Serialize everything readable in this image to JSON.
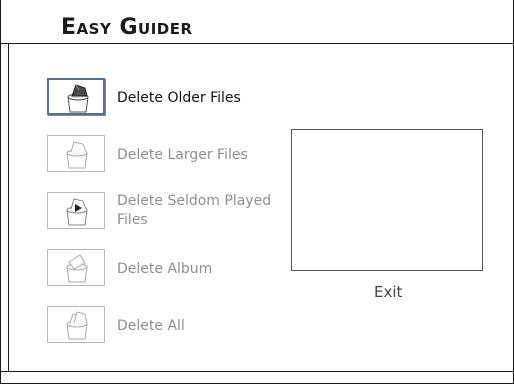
{
  "app": {
    "title": "Easy Guider"
  },
  "menu": {
    "items": [
      {
        "id": "older",
        "label": "Delete Older Files",
        "selected": true,
        "icon": "trash-bin-icon"
      },
      {
        "id": "larger",
        "label": "Delete Larger Files",
        "selected": false,
        "icon": "trash-bin-icon"
      },
      {
        "id": "seldom",
        "label": "Delete Seldom Played Files",
        "selected": false,
        "icon": "trash-bin-play-icon"
      },
      {
        "id": "album",
        "label": "Delete Album",
        "selected": false,
        "icon": "trash-bin-album-icon"
      },
      {
        "id": "all",
        "label": "Delete All",
        "selected": false,
        "icon": "trash-bin-stack-icon"
      }
    ]
  },
  "exit": {
    "label": "Exit"
  },
  "colors": {
    "selected_border": "#5b6e86",
    "dim_text": "#8f8f8f",
    "active_text": "#111111"
  }
}
